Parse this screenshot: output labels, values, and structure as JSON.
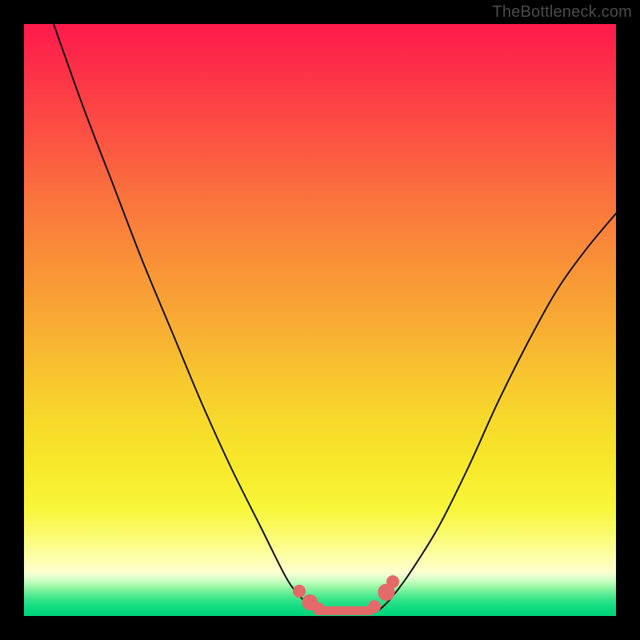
{
  "watermark": "TheBottleneck.com",
  "colors": {
    "left_curve": "#111111",
    "right_curve": "#111111",
    "accent_pink": "#e46a6a",
    "frame": "#000000"
  },
  "chart_data": {
    "type": "line",
    "title": "",
    "xlabel": "",
    "ylabel": "",
    "xlim": [
      0,
      100
    ],
    "ylim": [
      0,
      100
    ],
    "series": [
      {
        "name": "left-curve",
        "x": [
          5,
          10,
          15,
          20,
          25,
          30,
          35,
          40,
          44,
          46,
          48,
          50
        ],
        "y": [
          100,
          86,
          73,
          60,
          48,
          36,
          25,
          15,
          7,
          4,
          2,
          0.8
        ]
      },
      {
        "name": "right-curve",
        "x": [
          60,
          62,
          65,
          70,
          75,
          80,
          85,
          90,
          95,
          100
        ],
        "y": [
          1,
          3,
          7,
          15,
          25,
          36,
          46,
          55,
          62,
          68
        ]
      }
    ],
    "accent_segment": {
      "note": "pink flat segment and dots near bottom green band",
      "line": {
        "x": [
          50.5,
          58.5
        ],
        "y": [
          0.9,
          0.9
        ]
      },
      "dots": [
        {
          "x": 46.5,
          "y": 4.2,
          "r": 0.9
        },
        {
          "x": 48.3,
          "y": 2.3,
          "r": 1.2
        },
        {
          "x": 49.8,
          "y": 1.2,
          "r": 0.9
        },
        {
          "x": 59.2,
          "y": 1.6,
          "r": 0.9
        },
        {
          "x": 61.2,
          "y": 4.0,
          "r": 1.3
        },
        {
          "x": 62.3,
          "y": 5.8,
          "r": 0.9
        }
      ]
    },
    "background_gradient_note": "smooth vertical gradient red→orange→yellow→pale→green; no visible axis ticks or labels"
  }
}
